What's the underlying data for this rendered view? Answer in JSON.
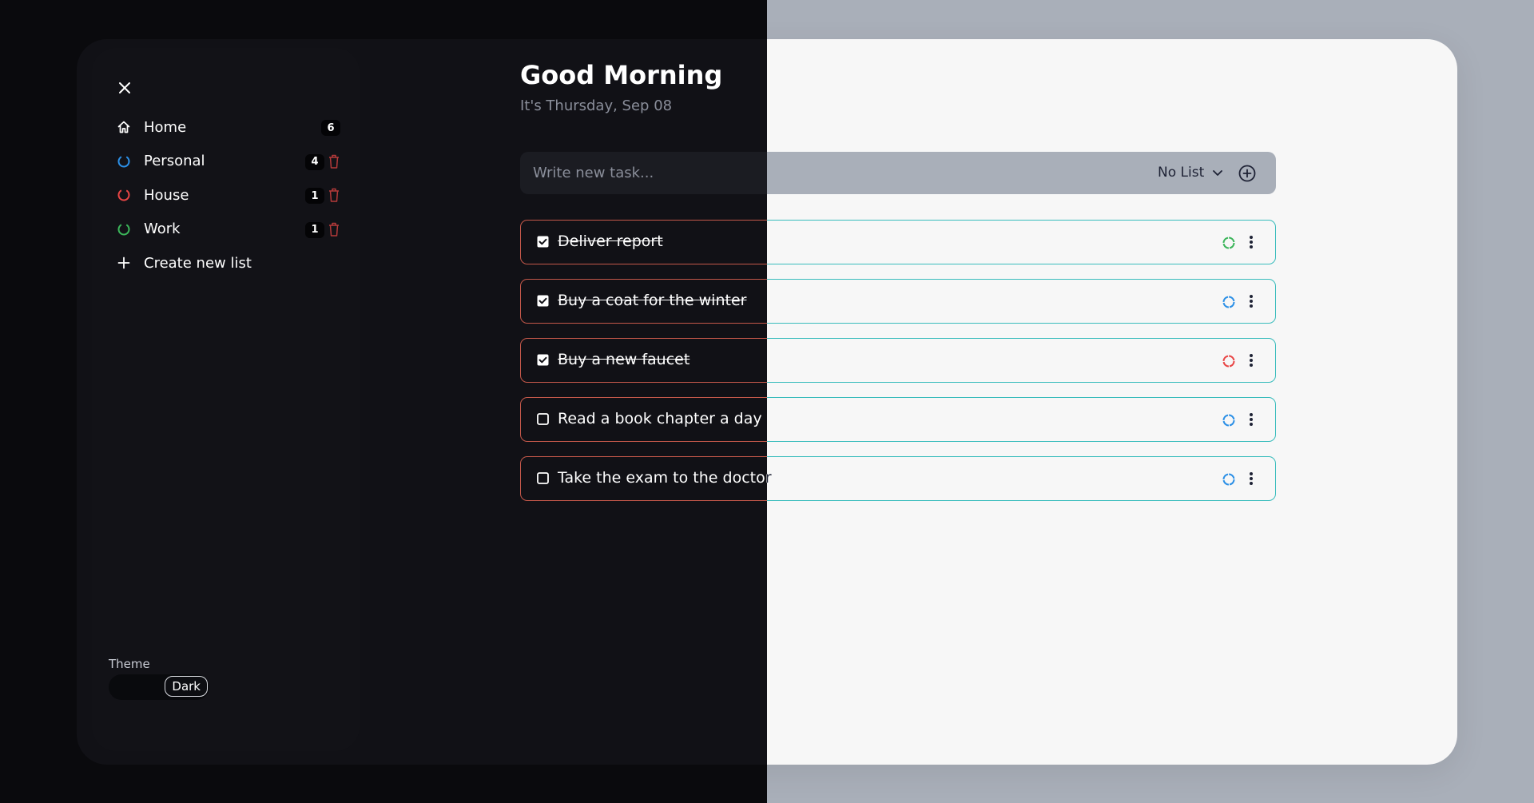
{
  "sidebar": {
    "close_icon": "close-icon",
    "items": [
      {
        "label": "Home",
        "count": "6",
        "icon": "home-icon",
        "color": "#1e2235"
      },
      {
        "label": "Personal",
        "count": "4",
        "icon": "ring-icon",
        "color": "#2b8fe6",
        "deletable": true
      },
      {
        "label": "House",
        "count": "1",
        "icon": "ring-icon",
        "color": "#e84545",
        "deletable": true
      },
      {
        "label": "Work",
        "count": "1",
        "icon": "ring-icon",
        "color": "#3bb55a",
        "deletable": true
      }
    ],
    "create_label": "Create new list",
    "trash_color": "#b43a3a",
    "theme_label": "Theme",
    "theme_value": "Dark"
  },
  "main": {
    "greeting": "Good Morning",
    "date": "It's Thursday, Sep 08",
    "task_input_placeholder": "Write new task...",
    "list_select_label": "No List",
    "tasks": [
      {
        "title": "Deliver report",
        "done": true,
        "list_color": "#3bb55a"
      },
      {
        "title": "Buy a coat for the winter",
        "done": true,
        "list_color": "#2b8fe6"
      },
      {
        "title": "Buy a new faucet",
        "done": true,
        "list_color": "#e84545"
      },
      {
        "title": "Read a book chapter a day",
        "done": false,
        "list_color": "#2b8fe6"
      },
      {
        "title": "Take the exam to the doctor",
        "done": false,
        "list_color": "#2b8fe6"
      }
    ]
  },
  "colors": {
    "light_bg": "#a9afb9",
    "dark_bg": "#0a0a0d",
    "task_border_light": "#38bcbc",
    "task_border_dark": "#c4584a"
  }
}
